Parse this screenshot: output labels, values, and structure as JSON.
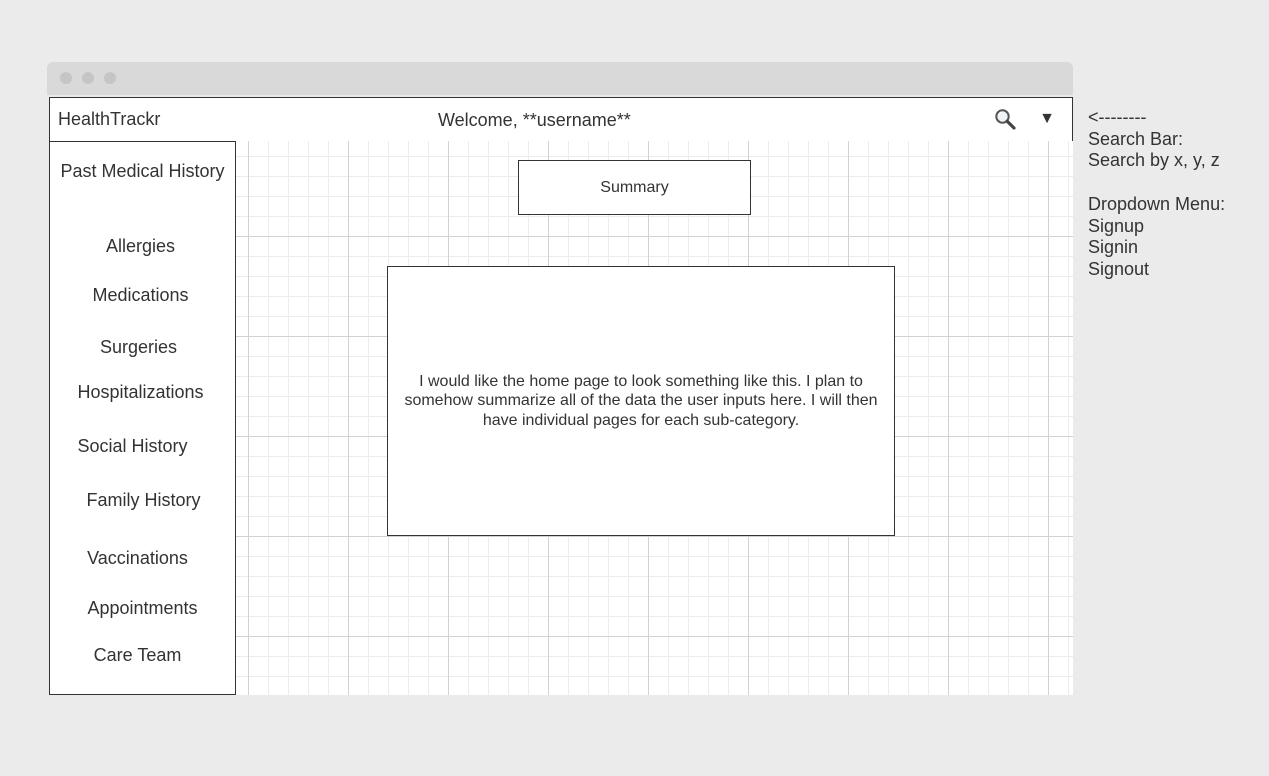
{
  "header": {
    "app_name": "HealthTrackr",
    "welcome": "Welcome, **username**",
    "search_icon": "search-icon",
    "dropdown_icon": "dropdown-triangle-icon",
    "dropdown_glyph": "▼"
  },
  "sidebar": {
    "items": [
      {
        "label": "Past Medical History"
      },
      {
        "label": "Allergies"
      },
      {
        "label": "Medications"
      },
      {
        "label": "Surgeries"
      },
      {
        "label": "Hospitalizations"
      },
      {
        "label": "Social History"
      },
      {
        "label": "Family History"
      },
      {
        "label": "Vaccinations"
      },
      {
        "label": "Appointments"
      },
      {
        "label": "Care Team"
      }
    ]
  },
  "main": {
    "summary_label": "Summary",
    "description": "I would like the home page to look something like this. I plan to somehow summarize all of the data the user inputs here. I will then have individual pages for each sub-category."
  },
  "notes": {
    "arrow": "<--------",
    "search_title": "Search Bar:",
    "search_desc": "Search by x, y, z",
    "dropdown_title": "Dropdown Menu:",
    "dropdown_items": [
      "Signup",
      "Signin",
      "Signout"
    ]
  },
  "colors": {
    "background": "#ebebeb",
    "titlebar": "#d9d9d9",
    "border": "#333333",
    "text": "#333333"
  }
}
